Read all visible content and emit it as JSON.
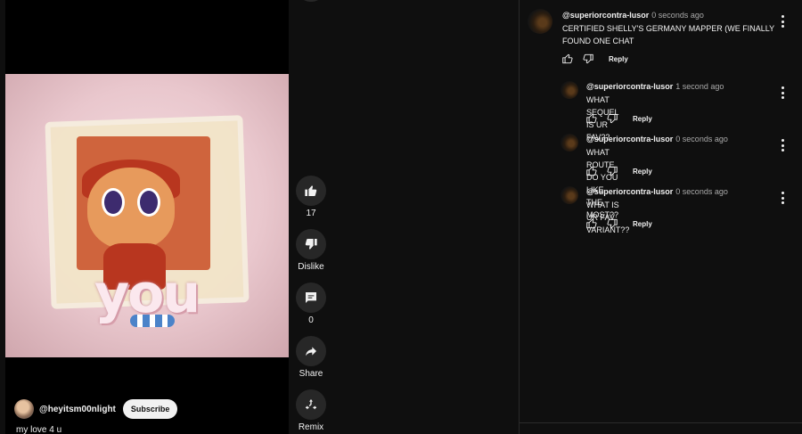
{
  "video": {
    "thumbnail_text": "you",
    "channel_handle": "@heyitsm00nlight",
    "subscribe_label": "Subscribe",
    "caption": "my love 4 u"
  },
  "actions": {
    "like_count": "17",
    "dislike_label": "Dislike",
    "comment_count": "0",
    "share_label": "Share",
    "remix_label": "Remix"
  },
  "comments": [
    {
      "author": "@superiorcontra-lusor",
      "time": "0 seconds ago",
      "text_line1": "CERTIFIED SHELLY'S GERMANY MAPPER (WE FINALLY",
      "text_line2": "FOUND ONE CHAT",
      "reply_label": "Reply"
    },
    {
      "author": "@superiorcontra-lusor",
      "time": "1 second ago",
      "text": "WHAT SEQUEL IS UR FAV??",
      "reply_label": "Reply"
    },
    {
      "author": "@superiorcontra-lusor",
      "time": "0 seconds ago",
      "text": "WHAT ROUTE DO YOU LIKE THE MOST??",
      "reply_label": "Reply"
    },
    {
      "author": "@superiorcontra-lusor",
      "time": "0 seconds ago",
      "text": "WHAT IS UR FAV VARIANT??",
      "reply_label": "Reply"
    }
  ]
}
